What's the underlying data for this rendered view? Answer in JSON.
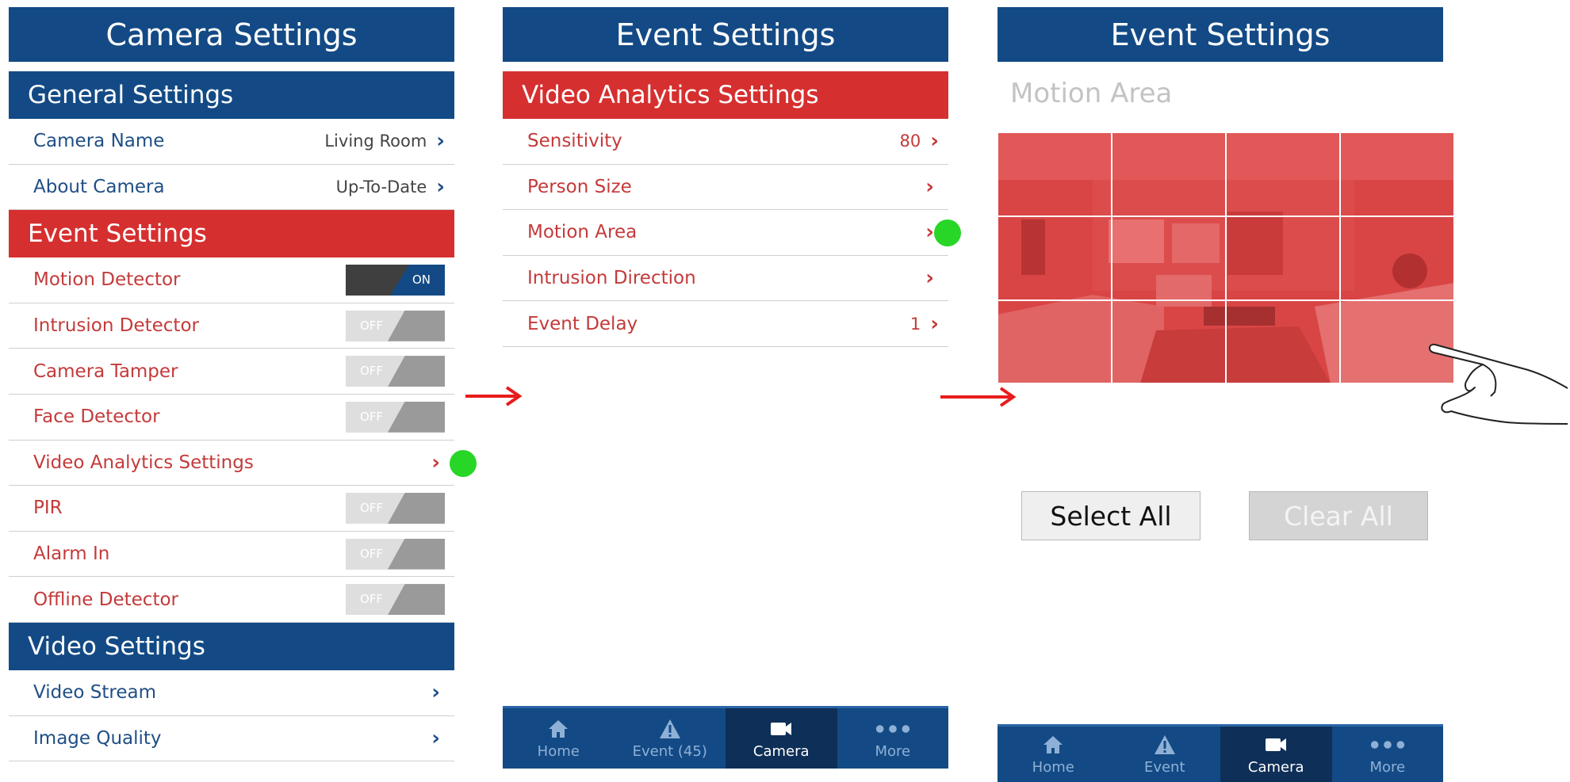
{
  "panel1": {
    "title": "Camera Settings",
    "general_header": "General Settings",
    "general_items": [
      {
        "label": "Camera Name",
        "value": "Living Room"
      },
      {
        "label": "About Camera",
        "value": "Up-To-Date"
      }
    ],
    "event_header": "Event Settings",
    "event_items": [
      {
        "label": "Motion Detector",
        "toggle": "ON"
      },
      {
        "label": "Intrusion Detector",
        "toggle": "OFF"
      },
      {
        "label": "Camera Tamper",
        "toggle": "OFF"
      },
      {
        "label": "Face Detector",
        "toggle": "OFF"
      },
      {
        "label": "Video Analytics Settings"
      },
      {
        "label": "PIR",
        "toggle": "OFF"
      },
      {
        "label": "Alarm In",
        "toggle": "OFF"
      },
      {
        "label": "Offline Detector",
        "toggle": "OFF"
      }
    ],
    "video_header": "Video Settings",
    "video_items": [
      {
        "label": "Video Stream"
      },
      {
        "label": "Image Quality"
      }
    ]
  },
  "panel2": {
    "title": "Event Settings",
    "section_header": "Video Analytics Settings",
    "items": [
      {
        "label": "Sensitivity",
        "value": "80"
      },
      {
        "label": "Person Size",
        "value": ""
      },
      {
        "label": "Motion Area",
        "value": ""
      },
      {
        "label": "Intrusion Direction",
        "value": ""
      },
      {
        "label": "Event Delay",
        "value": "1"
      }
    ]
  },
  "panel3": {
    "title": "Event Settings",
    "motion_area_label": "Motion Area",
    "select_all": "Select All",
    "clear_all": "Clear All"
  },
  "nav_panel2": [
    {
      "label": "Home",
      "icon": "home-icon"
    },
    {
      "label": "Event (45)",
      "icon": "warning-icon"
    },
    {
      "label": "Camera",
      "icon": "camera-icon",
      "active": true
    },
    {
      "label": "More",
      "icon": "more-dots-icon"
    }
  ],
  "nav_panel3": [
    {
      "label": "Home",
      "icon": "home-icon"
    },
    {
      "label": "Event",
      "icon": "warning-icon"
    },
    {
      "label": "Camera",
      "icon": "camera-icon",
      "active": true
    },
    {
      "label": "More",
      "icon": "more-dots-icon"
    }
  ],
  "colors": {
    "primary_blue": "#134a85",
    "event_red": "#d62f2f",
    "highlight_green": "#27d627",
    "arrow_red": "#e81c1c"
  }
}
